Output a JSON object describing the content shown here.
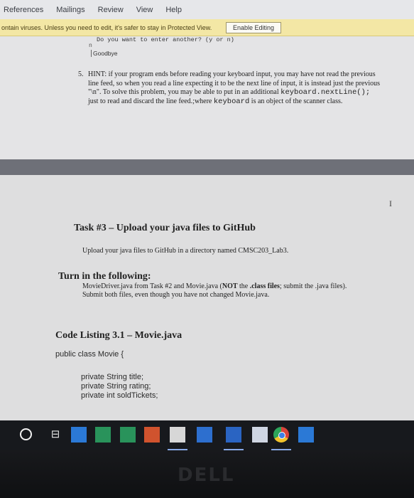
{
  "ribbon": {
    "tabs": [
      "References",
      "Mailings",
      "Review",
      "View",
      "Help"
    ]
  },
  "protected_view": {
    "message": "ontain viruses. Unless you need to edit, it's safer to stay in Protected View.",
    "enable_label": "Enable Editing"
  },
  "document": {
    "console_prompt": "Do you want to enter another? (y or n)",
    "console_input": "n",
    "console_goodbye": "Goodbye",
    "hint": {
      "number": "5.",
      "part1": "HINT: if your program ends before reading your keyboard input, you may have not read the previous line feed, so when you read a line expecting it to be the next line of input, it is instead just the previous \"\\n\". To solve this problem, you may be able to put in an additional ",
      "code1": "keyboard.nextLine();",
      "part2": " just to read and discard the line feed.;where ",
      "code2": "keyboard",
      "part3": " is an object of the scanner class."
    },
    "task3_heading": "Task #3 – Upload your java files to GitHub",
    "upload_text": "Upload your java files to GitHub in a directory named CMSC203_Lab3.",
    "turnin_heading": "Turn in the following:",
    "turnin": {
      "part1": "MovieDriver.java from Task #2 and Movie.java (",
      "bold1": "NOT",
      "part2": " the ",
      "bold2": ".class files",
      "part3": "; submit the .java files). Submit both files, even though you have not changed Movie.java."
    },
    "code_listing_heading": "Code Listing 3.1 – Movie.java",
    "code_lines": [
      "public class Movie {",
      "private String title;",
      "private String rating;",
      "private int soldTickets;"
    ],
    "ibeam": "I"
  },
  "taskbar": {
    "taskview_glyph": "⊟"
  },
  "bezel": {
    "brand": "DELL"
  }
}
